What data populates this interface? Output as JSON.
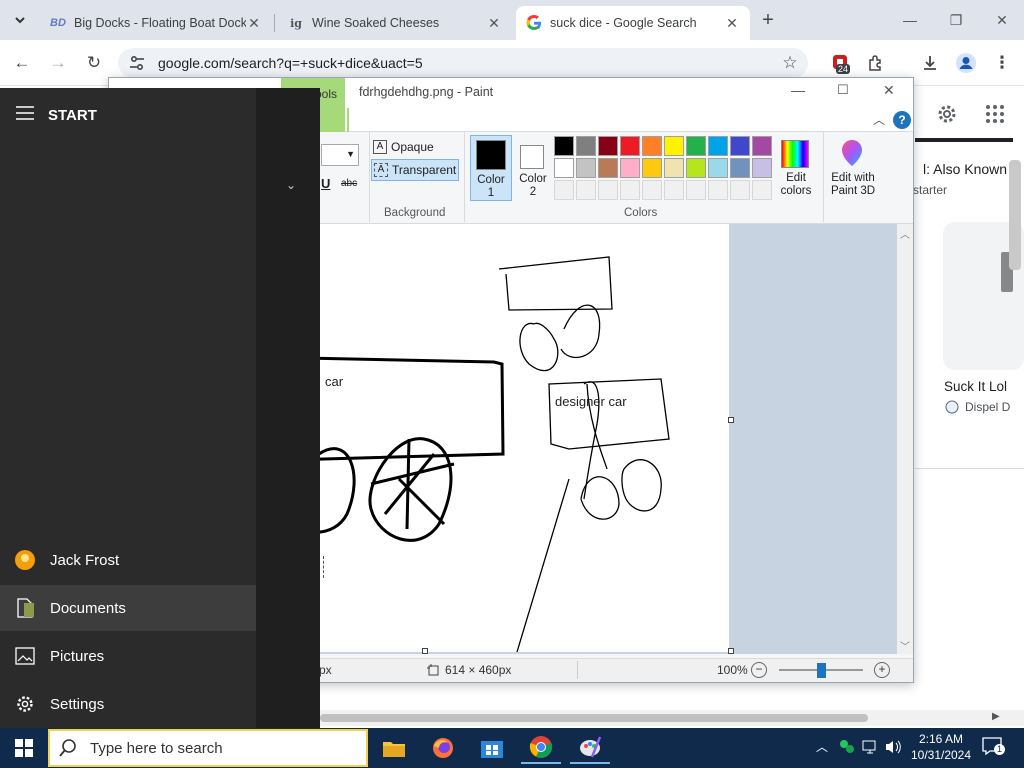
{
  "browser": {
    "tabs": [
      {
        "favicon": "BD",
        "title": "Big Docks - Floating Boat Dock",
        "active": false
      },
      {
        "favicon": "ig",
        "title": "Wine Soaked Cheeses",
        "active": false
      },
      {
        "favicon": "G",
        "title": "suck dice - Google Search",
        "active": true
      }
    ],
    "new_tab": "+",
    "address": "google.com/search?q=+suck+dice&uact=5",
    "extension_badge": "24",
    "colors": {
      "tabstrip": "#dfe3eb",
      "accent": "#1a73e8"
    }
  },
  "google": {
    "result_title": "l: Also Known A",
    "result_sub": "starter",
    "card_title": "Suck It Lol",
    "card_source": "Dispel D"
  },
  "paint": {
    "filename": "fdrhgdehdhg.png - Paint",
    "tab_partial": "ools",
    "opaque_label": "Opaque",
    "transparent_label": "Transparent",
    "background_group": "Background",
    "color1_label": "Color 1",
    "color2_label": "Color 2",
    "colors_group": "Colors",
    "edit_colors": "Edit colors",
    "edit_paint3d": "Edit with Paint 3D",
    "palette_row1": [
      "#000000",
      "#7f7f7f",
      "#880015",
      "#ed1c24",
      "#ff7f27",
      "#fff200",
      "#22b14c",
      "#00a2e8",
      "#3f48cc",
      "#a349a4"
    ],
    "palette_row2": [
      "#ffffff",
      "#c3c3c3",
      "#b97a57",
      "#ffaec9",
      "#ffc90e",
      "#efe4b0",
      "#b5e61d",
      "#99d9ea",
      "#7092be",
      "#c8bfe7"
    ],
    "canvas_text_1": "car",
    "canvas_text_2": "designer car",
    "status_partial": "px",
    "dimensions": "614 × 460px",
    "zoom": "100%"
  },
  "start_menu": {
    "header": "START",
    "user": "Jack Frost",
    "items": [
      "Documents",
      "Pictures",
      "Settings"
    ]
  },
  "taskbar": {
    "search_placeholder": "Type here to search",
    "time": "2:16 AM",
    "date": "10/31/2024",
    "notification_count": "1"
  }
}
